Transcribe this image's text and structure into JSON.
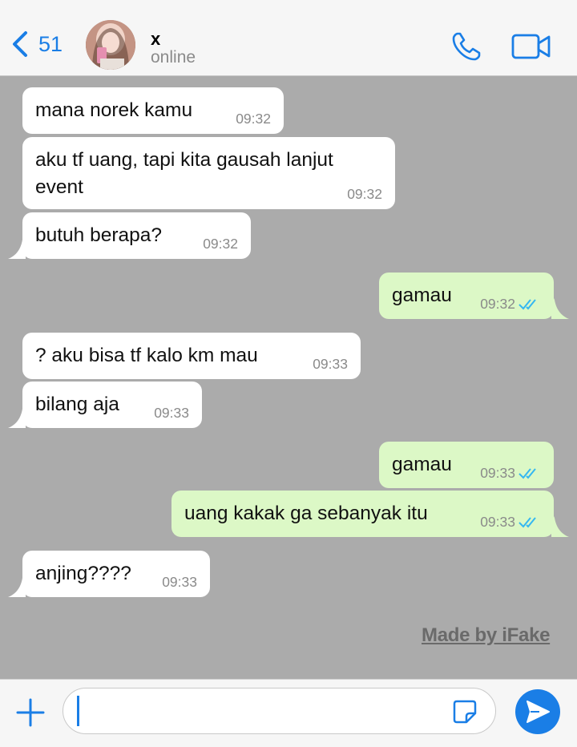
{
  "header": {
    "back_count": "51",
    "contact_name": "x",
    "contact_status": "online"
  },
  "messages": [
    {
      "direction": "in",
      "text": "mana norek kamu",
      "time": "09:32"
    },
    {
      "direction": "in",
      "text": "aku tf uang, tapi kita gausah lanjut event",
      "time": "09:32"
    },
    {
      "direction": "in",
      "text": "butuh berapa?",
      "time": "09:32"
    },
    {
      "direction": "out",
      "text": "gamau",
      "time": "09:32",
      "status": "read"
    },
    {
      "direction": "in",
      "text": "? aku bisa tf kalo km mau",
      "time": "09:33"
    },
    {
      "direction": "in",
      "text": "bilang aja",
      "time": "09:33"
    },
    {
      "direction": "out",
      "text": "gamau",
      "time": "09:33",
      "status": "read"
    },
    {
      "direction": "out",
      "text": "uang kakak ga sebanyak itu",
      "time": "09:33",
      "status": "read"
    },
    {
      "direction": "in",
      "text": "anjing????",
      "time": "09:33"
    }
  ],
  "watermark": "Made by iFake",
  "input": {
    "value": "",
    "placeholder": ""
  },
  "colors": {
    "accent": "#1a7ee6",
    "chat_background": "#ababab",
    "incoming_bubble": "#ffffff",
    "outgoing_bubble": "#dcf8c6",
    "read_ticks": "#34b7f1"
  },
  "icons": {
    "back": "chevron-left-icon",
    "call": "phone-icon",
    "video": "video-camera-icon",
    "attach": "plus-icon",
    "sticker": "sticker-icon",
    "send": "send-icon"
  }
}
